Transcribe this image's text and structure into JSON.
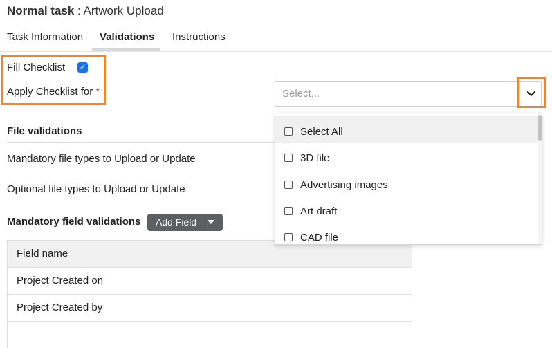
{
  "header": {
    "title_bold": "Normal task",
    "title_rest": " : Artwork Upload"
  },
  "tabs": [
    {
      "label": "Task Information",
      "active": false
    },
    {
      "label": "Validations",
      "active": true
    },
    {
      "label": "Instructions",
      "active": false
    }
  ],
  "checklist": {
    "fill_label": "Fill Checklist",
    "fill_checked": true,
    "apply_label": "Apply Checklist for",
    "required_mark": "*",
    "select_placeholder": "Select..."
  },
  "file_validations": {
    "title": "File validations",
    "mandatory_label": "Mandatory file types to Upload or Update",
    "optional_label": "Optional file types to Upload or Update"
  },
  "field_validations": {
    "title": "Mandatory field validations",
    "add_button": "Add Field",
    "table": {
      "header": "Field name",
      "rows": [
        "Project Created on",
        "Project Created by",
        ""
      ]
    }
  },
  "dropdown": {
    "options": [
      {
        "label": "Select All",
        "checked": false
      },
      {
        "label": "3D file",
        "checked": false
      },
      {
        "label": "Advertising images",
        "checked": false
      },
      {
        "label": "Art draft",
        "checked": false
      },
      {
        "label": "CAD file",
        "checked": false
      }
    ]
  },
  "colors": {
    "accent": "#1a73e8",
    "highlight": "#f2842b",
    "button": "#5d6063",
    "required": "#d93025"
  }
}
